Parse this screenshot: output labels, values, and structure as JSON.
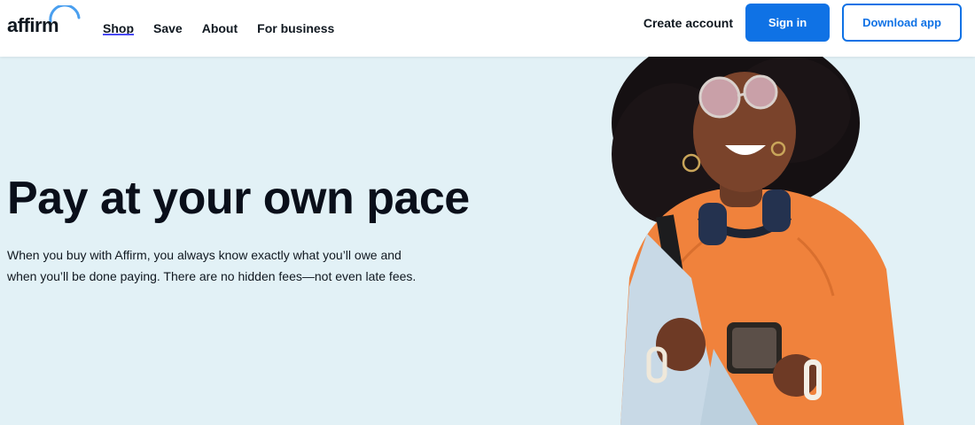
{
  "brand": {
    "name": "affirm"
  },
  "nav": {
    "items": [
      {
        "label": "Shop",
        "active": true
      },
      {
        "label": "Save",
        "active": false
      },
      {
        "label": "About",
        "active": false
      },
      {
        "label": "For business",
        "active": false
      }
    ]
  },
  "actions": {
    "create_account": "Create account",
    "sign_in": "Sign in",
    "download_app": "Download app"
  },
  "hero": {
    "title": "Pay at your own pace",
    "description": "When you buy with Affirm, you always know exactly what you’ll owe and when you’ll be done paying. There are no hidden fees—not even late fees."
  },
  "colors": {
    "accent": "#0f72e5",
    "hero_background": "#e2f1f6",
    "nav_underline": "#4a4af4"
  }
}
